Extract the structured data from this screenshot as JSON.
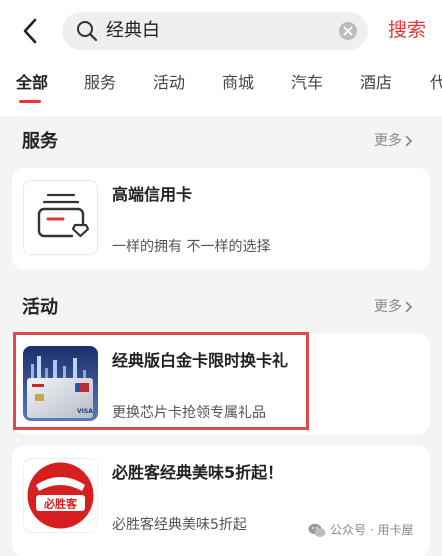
{
  "search": {
    "query": "经典白",
    "button": "搜索"
  },
  "tabs": [
    {
      "label": "全部"
    },
    {
      "label": "服务"
    },
    {
      "label": "活动"
    },
    {
      "label": "商城"
    },
    {
      "label": "汽车"
    },
    {
      "label": "酒店"
    },
    {
      "label": "代"
    }
  ],
  "active_tab": "全部",
  "sections": {
    "services": {
      "title": "服务",
      "more": "更多",
      "items": [
        {
          "title": "高端信用卡",
          "subtitle": "一样的拥有 不一样的选择"
        }
      ]
    },
    "activities": {
      "title": "活动",
      "more": "更多",
      "items": [
        {
          "title": "经典版白金卡限时换卡礼",
          "subtitle": "更换芯片卡抢领专属礼品"
        },
        {
          "title": "必胜客经典美味5折起！",
          "subtitle": "必胜客经典美味5折起",
          "logo_text": "必胜客"
        }
      ]
    }
  },
  "watermark": "公众号 · 用卡屋",
  "colors": {
    "accent": "#e8343b",
    "highlight_border": "#e04a4a"
  }
}
